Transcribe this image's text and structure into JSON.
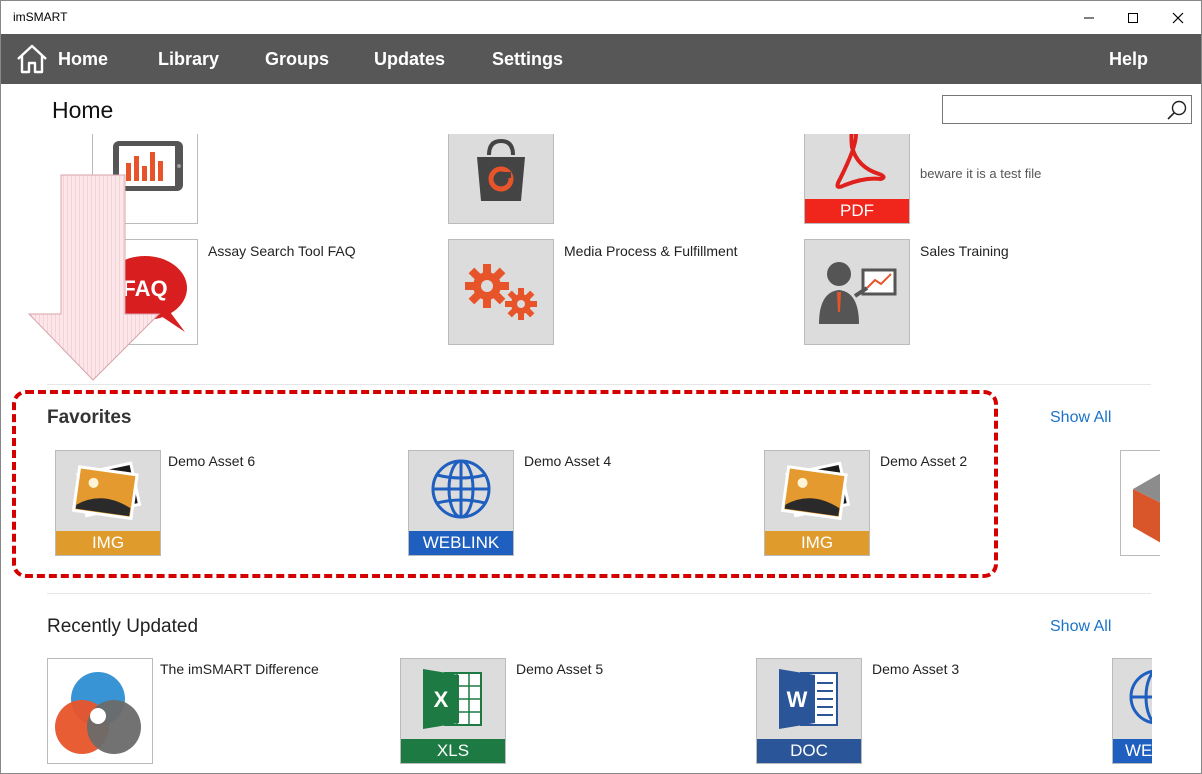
{
  "window": {
    "title": "imSMART"
  },
  "nav": {
    "home": "Home",
    "library": "Library",
    "groups": "Groups",
    "updates": "Updates",
    "settings": "Settings",
    "help": "Help"
  },
  "page": {
    "title": "Home"
  },
  "search": {
    "value": "",
    "placeholder": ""
  },
  "top_items": [
    {
      "label": "",
      "icon": "tablet-chart-icon"
    },
    {
      "label": "",
      "icon": "shopping-bag-icon"
    },
    {
      "label": "",
      "desc": "beware it is a test file",
      "icon": "pdf-icon",
      "type": "PDF"
    },
    {
      "label": "Assay Search Tool FAQ",
      "icon": "faq-bubble-icon"
    },
    {
      "label": "Media Process & Fulfillment",
      "icon": "gears-icon"
    },
    {
      "label": "Sales Training",
      "icon": "presenter-icon"
    }
  ],
  "favorites": {
    "title": "Favorites",
    "show_all": "Show All",
    "items": [
      {
        "label": "Demo Asset 6",
        "type": "IMG",
        "icon": "image-icon"
      },
      {
        "label": "Demo Asset 4",
        "type": "WEBLINK",
        "icon": "globe-icon"
      },
      {
        "label": "Demo Asset 2",
        "type": "IMG",
        "icon": "image-icon"
      }
    ]
  },
  "recent": {
    "title": "Recently Updated",
    "show_all": "Show All",
    "items": [
      {
        "label": "The imSMART Difference",
        "icon": "venn-diagram-icon"
      },
      {
        "label": "Demo Asset 5",
        "type": "XLS",
        "icon": "excel-icon"
      },
      {
        "label": "Demo Asset 3",
        "type": "DOC",
        "icon": "word-icon"
      },
      {
        "label": "",
        "type": "WE",
        "icon": "globe-icon"
      }
    ]
  },
  "colors": {
    "nav_bg": "#575757",
    "accent_link": "#1a73c8",
    "img_band": "#e09b2d",
    "weblink_band": "#1f5fbf",
    "xls_band": "#1e7a43",
    "doc_band": "#2a5699",
    "pdf_band": "#f0261c",
    "highlight": "#d40000"
  }
}
